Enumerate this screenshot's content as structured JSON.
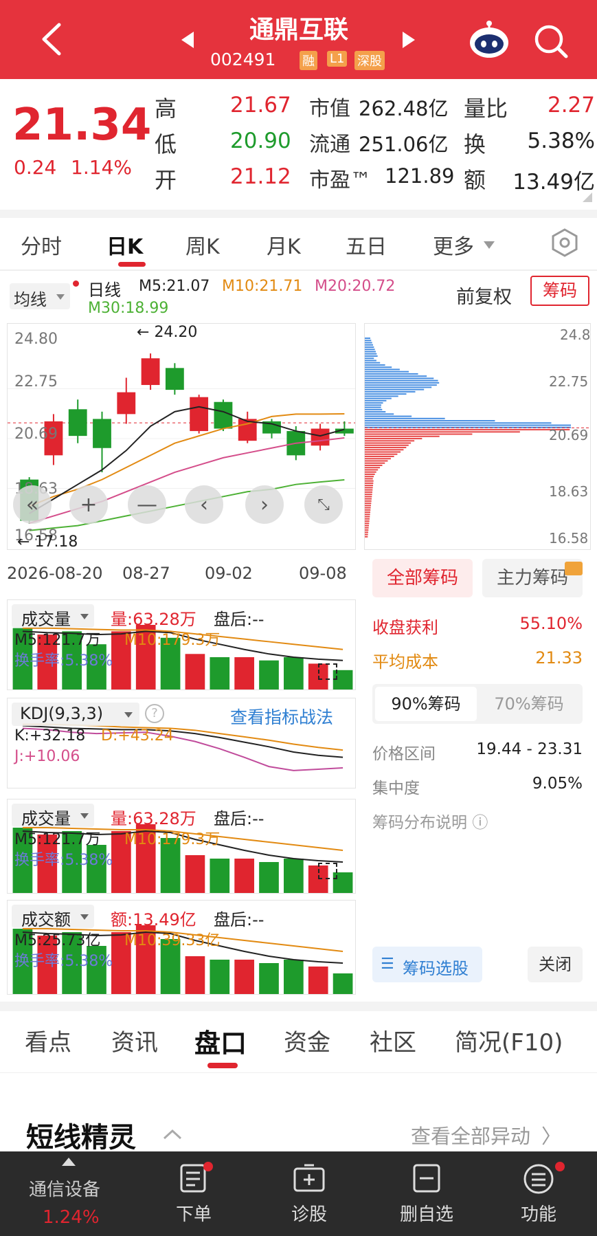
{
  "header": {
    "title": "通鼎互联",
    "code": "002491",
    "badges": [
      "融",
      "L1",
      "深股"
    ]
  },
  "quote": {
    "price": "21.34",
    "change": "0.24",
    "change_pct": "1.14%",
    "rows": [
      {
        "l1": "高",
        "v1": "21.67",
        "l2": "市值",
        "v2": "262.48亿",
        "l3": "量比",
        "v3": "2.27"
      },
      {
        "l1": "低",
        "v1": "20.90",
        "l2": "流通",
        "v2": "251.06亿",
        "l3": "换",
        "v3": "5.38%"
      },
      {
        "l1": "开",
        "v1": "21.12",
        "l2": "市盈™",
        "v2": "121.89",
        "l3": "额",
        "v3": "13.49亿"
      }
    ]
  },
  "tabs": [
    "分时",
    "日K",
    "周K",
    "月K",
    "五日",
    "更多"
  ],
  "ma_bar": {
    "selector": "均线",
    "line_label": "日线",
    "m5": "M5:21.07",
    "m10": "M10:21.71",
    "m20": "M20:20.72",
    "m30": "M30:18.99",
    "fq": "前复权",
    "chip_btn": "筹码"
  },
  "kline": {
    "y_labels": [
      "24.80",
      "22.75",
      "20.69",
      "18.63",
      "16.58"
    ],
    "high_label": "24.20",
    "low_label": "17.18",
    "x_labels": [
      "2026-08-20",
      "08-27",
      "09-02",
      "09-08"
    ],
    "candles": [
      {
        "o": 19.0,
        "c": 17.3,
        "h": 19.1,
        "l": 17.18
      },
      {
        "o": 20.0,
        "c": 21.4,
        "h": 21.7,
        "l": 19.6
      },
      {
        "o": 21.9,
        "c": 20.8,
        "h": 22.3,
        "l": 20.5
      },
      {
        "o": 21.5,
        "c": 20.3,
        "h": 21.8,
        "l": 19.3
      },
      {
        "o": 21.7,
        "c": 22.6,
        "h": 23.2,
        "l": 21.3
      },
      {
        "o": 22.9,
        "c": 24.0,
        "h": 24.2,
        "l": 22.7
      },
      {
        "o": 23.6,
        "c": 22.7,
        "h": 23.8,
        "l": 22.5
      },
      {
        "o": 21.0,
        "c": 22.4,
        "h": 22.5,
        "l": 20.9
      },
      {
        "o": 22.2,
        "c": 21.1,
        "h": 22.3,
        "l": 21.0
      },
      {
        "o": 20.6,
        "c": 21.5,
        "h": 21.8,
        "l": 20.5
      },
      {
        "o": 21.4,
        "c": 20.9,
        "h": 21.5,
        "l": 20.7
      },
      {
        "o": 21.0,
        "c": 20.0,
        "h": 21.2,
        "l": 19.8
      },
      {
        "o": 20.4,
        "c": 21.1,
        "h": 21.3,
        "l": 20.2
      },
      {
        "o": 21.1,
        "c": 20.9,
        "h": 21.4,
        "l": 20.8
      }
    ],
    "ma5": [
      17.6,
      18.2,
      18.8,
      19.4,
      20.2,
      21.2,
      21.8,
      22.0,
      21.8,
      21.4,
      21.3,
      21.0,
      20.8,
      21.07
    ],
    "ma10": [
      17.9,
      18.3,
      18.6,
      19.0,
      19.5,
      20.0,
      20.5,
      20.8,
      21.1,
      21.3,
      21.6,
      21.7,
      21.7,
      21.71
    ],
    "ma20": [
      17.2,
      17.5,
      17.8,
      18.1,
      18.5,
      18.9,
      19.3,
      19.6,
      19.9,
      20.1,
      20.3,
      20.5,
      20.6,
      20.72
    ],
    "ma30": [
      16.9,
      17.0,
      17.1,
      17.3,
      17.5,
      17.7,
      17.9,
      18.1,
      18.3,
      18.5,
      18.6,
      18.8,
      18.9,
      18.99
    ],
    "ylim": [
      16.58,
      24.8
    ]
  },
  "chip": {
    "y_labels": [
      "24.8",
      "22.75",
      "20.69",
      "18.63",
      "16.58"
    ],
    "tab_all": "全部筹码",
    "tab_main": "主力筹码",
    "profit_label": "收盘获利",
    "profit_value": "55.10%",
    "avg_label": "平均成本",
    "avg_value": "21.33",
    "pct90": "90%筹码",
    "pct70": "70%筹码",
    "range_label": "价格区间",
    "range_value": "19.44 - 23.31",
    "conc_label": "集中度",
    "conc_value": "9.05%",
    "explain": "筹码分布说明",
    "select_btn": "筹码选股",
    "close_btn": "关闭"
  },
  "vol1": {
    "title": "成交量",
    "v": "量:63.28万",
    "after": "盘后:--",
    "m5": "M5:121.7万",
    "m10": "M10:179.3万",
    "turnover": "换手率:5.38%"
  },
  "kdj": {
    "title": "KDJ(9,3,3)",
    "link": "查看指标战法",
    "k": "K:+32.18",
    "d": "D:+43.24",
    "j": "J:+10.06"
  },
  "vol2": {
    "title": "成交量",
    "v": "量:63.28万",
    "after": "盘后:--",
    "m5": "M5:121.7万",
    "m10": "M10:179.3万",
    "turnover": "换手率:5.38%"
  },
  "amt": {
    "title": "成交额",
    "v": "额:13.49亿",
    "after": "盘后:--",
    "m5": "M5:25.73亿",
    "m10": "M10:39.33亿",
    "turnover": "换手率:5.38%"
  },
  "volumes": [
    0.95,
    0.85,
    0.9,
    0.7,
    0.9,
    1.0,
    0.8,
    0.55,
    0.5,
    0.5,
    0.45,
    0.5,
    0.4,
    0.3
  ],
  "bottom_tabs": [
    "看点",
    "资讯",
    "盘口",
    "资金",
    "社区",
    "简况(F10)"
  ],
  "section": {
    "title": "短线精灵",
    "link": "查看全部异动"
  },
  "nav": {
    "sector": "通信设备",
    "sector_pct": "1.24%",
    "items": [
      "下单",
      "诊股",
      "删自选",
      "功能"
    ]
  },
  "colors": {
    "up": "#e0252f",
    "down": "#1e9b2c",
    "header": "#e5333d"
  }
}
